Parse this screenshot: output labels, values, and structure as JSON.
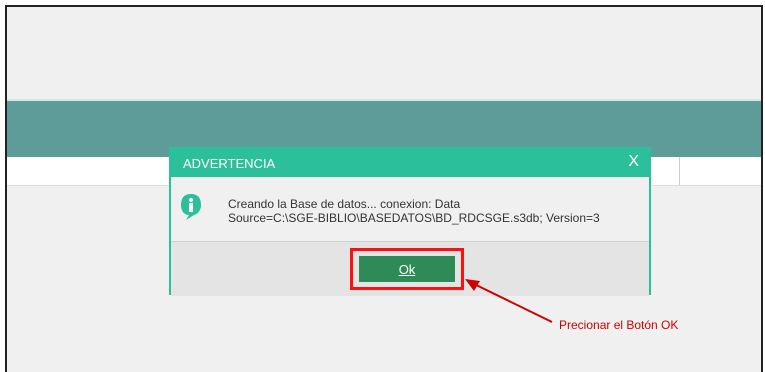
{
  "dialog": {
    "title": "ADVERTENCIA",
    "close_label": "X",
    "message_line1": "Creando la Base de datos... conexion: Data",
    "message_line2": "Source=C:\\SGE-BIBLIO\\BASEDATOS\\BD_RDCSGE.s3db; Version=3",
    "ok_label": "Ok",
    "icon": "info-icon"
  },
  "annotation": {
    "text": "Precionar el Botón OK",
    "color": "#d10000"
  },
  "colors": {
    "accent": "#2bbf9c",
    "teal_bar": "#5e9c9a",
    "ok_button": "#2e8b57"
  }
}
